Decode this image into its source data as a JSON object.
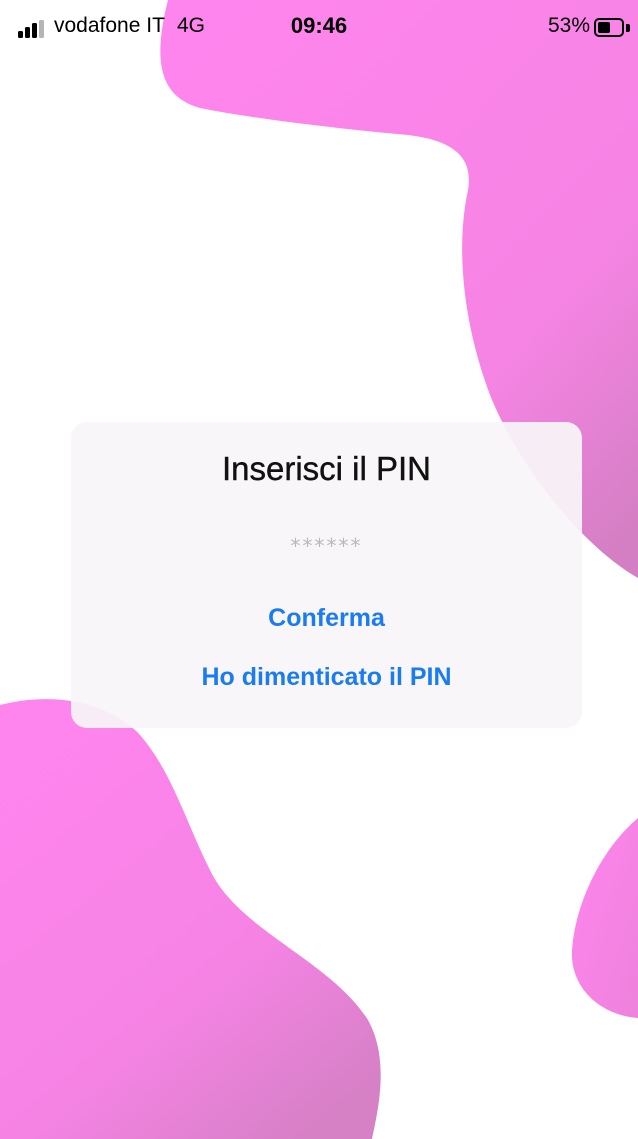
{
  "status_bar": {
    "carrier": "vodafone IT",
    "network": "4G",
    "time": "09:46",
    "battery_percent": "53%",
    "battery_level": 0.53,
    "signal_bars_filled": 3,
    "signal_bars_total": 4
  },
  "theme": {
    "blob_color": "#ff85ee",
    "blob_color_dark": "#d97cc4",
    "link_color": "#1a7cf0",
    "background": "#ffffff"
  },
  "dialog": {
    "title": "Inserisci il PIN",
    "pin_placeholder": "******",
    "pin_value": "",
    "confirm_label": "Conferma",
    "forgot_label": "Ho dimenticato il PIN"
  }
}
